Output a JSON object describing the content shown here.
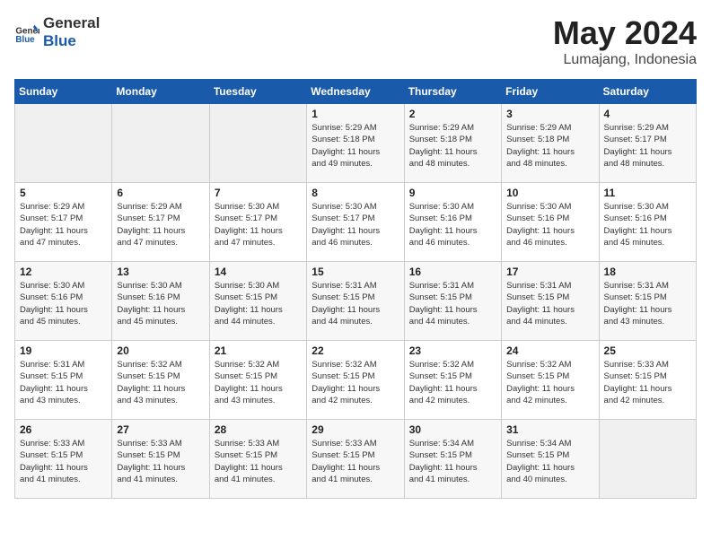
{
  "header": {
    "logo_general": "General",
    "logo_blue": "Blue",
    "month_year": "May 2024",
    "location": "Lumajang, Indonesia"
  },
  "weekdays": [
    "Sunday",
    "Monday",
    "Tuesday",
    "Wednesday",
    "Thursday",
    "Friday",
    "Saturday"
  ],
  "weeks": [
    [
      {
        "day": "",
        "info": ""
      },
      {
        "day": "",
        "info": ""
      },
      {
        "day": "",
        "info": ""
      },
      {
        "day": "1",
        "info": "Sunrise: 5:29 AM\nSunset: 5:18 PM\nDaylight: 11 hours\nand 49 minutes."
      },
      {
        "day": "2",
        "info": "Sunrise: 5:29 AM\nSunset: 5:18 PM\nDaylight: 11 hours\nand 48 minutes."
      },
      {
        "day": "3",
        "info": "Sunrise: 5:29 AM\nSunset: 5:18 PM\nDaylight: 11 hours\nand 48 minutes."
      },
      {
        "day": "4",
        "info": "Sunrise: 5:29 AM\nSunset: 5:17 PM\nDaylight: 11 hours\nand 48 minutes."
      }
    ],
    [
      {
        "day": "5",
        "info": "Sunrise: 5:29 AM\nSunset: 5:17 PM\nDaylight: 11 hours\nand 47 minutes."
      },
      {
        "day": "6",
        "info": "Sunrise: 5:29 AM\nSunset: 5:17 PM\nDaylight: 11 hours\nand 47 minutes."
      },
      {
        "day": "7",
        "info": "Sunrise: 5:30 AM\nSunset: 5:17 PM\nDaylight: 11 hours\nand 47 minutes."
      },
      {
        "day": "8",
        "info": "Sunrise: 5:30 AM\nSunset: 5:17 PM\nDaylight: 11 hours\nand 46 minutes."
      },
      {
        "day": "9",
        "info": "Sunrise: 5:30 AM\nSunset: 5:16 PM\nDaylight: 11 hours\nand 46 minutes."
      },
      {
        "day": "10",
        "info": "Sunrise: 5:30 AM\nSunset: 5:16 PM\nDaylight: 11 hours\nand 46 minutes."
      },
      {
        "day": "11",
        "info": "Sunrise: 5:30 AM\nSunset: 5:16 PM\nDaylight: 11 hours\nand 45 minutes."
      }
    ],
    [
      {
        "day": "12",
        "info": "Sunrise: 5:30 AM\nSunset: 5:16 PM\nDaylight: 11 hours\nand 45 minutes."
      },
      {
        "day": "13",
        "info": "Sunrise: 5:30 AM\nSunset: 5:16 PM\nDaylight: 11 hours\nand 45 minutes."
      },
      {
        "day": "14",
        "info": "Sunrise: 5:30 AM\nSunset: 5:15 PM\nDaylight: 11 hours\nand 44 minutes."
      },
      {
        "day": "15",
        "info": "Sunrise: 5:31 AM\nSunset: 5:15 PM\nDaylight: 11 hours\nand 44 minutes."
      },
      {
        "day": "16",
        "info": "Sunrise: 5:31 AM\nSunset: 5:15 PM\nDaylight: 11 hours\nand 44 minutes."
      },
      {
        "day": "17",
        "info": "Sunrise: 5:31 AM\nSunset: 5:15 PM\nDaylight: 11 hours\nand 44 minutes."
      },
      {
        "day": "18",
        "info": "Sunrise: 5:31 AM\nSunset: 5:15 PM\nDaylight: 11 hours\nand 43 minutes."
      }
    ],
    [
      {
        "day": "19",
        "info": "Sunrise: 5:31 AM\nSunset: 5:15 PM\nDaylight: 11 hours\nand 43 minutes."
      },
      {
        "day": "20",
        "info": "Sunrise: 5:32 AM\nSunset: 5:15 PM\nDaylight: 11 hours\nand 43 minutes."
      },
      {
        "day": "21",
        "info": "Sunrise: 5:32 AM\nSunset: 5:15 PM\nDaylight: 11 hours\nand 43 minutes."
      },
      {
        "day": "22",
        "info": "Sunrise: 5:32 AM\nSunset: 5:15 PM\nDaylight: 11 hours\nand 42 minutes."
      },
      {
        "day": "23",
        "info": "Sunrise: 5:32 AM\nSunset: 5:15 PM\nDaylight: 11 hours\nand 42 minutes."
      },
      {
        "day": "24",
        "info": "Sunrise: 5:32 AM\nSunset: 5:15 PM\nDaylight: 11 hours\nand 42 minutes."
      },
      {
        "day": "25",
        "info": "Sunrise: 5:33 AM\nSunset: 5:15 PM\nDaylight: 11 hours\nand 42 minutes."
      }
    ],
    [
      {
        "day": "26",
        "info": "Sunrise: 5:33 AM\nSunset: 5:15 PM\nDaylight: 11 hours\nand 41 minutes."
      },
      {
        "day": "27",
        "info": "Sunrise: 5:33 AM\nSunset: 5:15 PM\nDaylight: 11 hours\nand 41 minutes."
      },
      {
        "day": "28",
        "info": "Sunrise: 5:33 AM\nSunset: 5:15 PM\nDaylight: 11 hours\nand 41 minutes."
      },
      {
        "day": "29",
        "info": "Sunrise: 5:33 AM\nSunset: 5:15 PM\nDaylight: 11 hours\nand 41 minutes."
      },
      {
        "day": "30",
        "info": "Sunrise: 5:34 AM\nSunset: 5:15 PM\nDaylight: 11 hours\nand 41 minutes."
      },
      {
        "day": "31",
        "info": "Sunrise: 5:34 AM\nSunset: 5:15 PM\nDaylight: 11 hours\nand 40 minutes."
      },
      {
        "day": "",
        "info": ""
      }
    ]
  ]
}
